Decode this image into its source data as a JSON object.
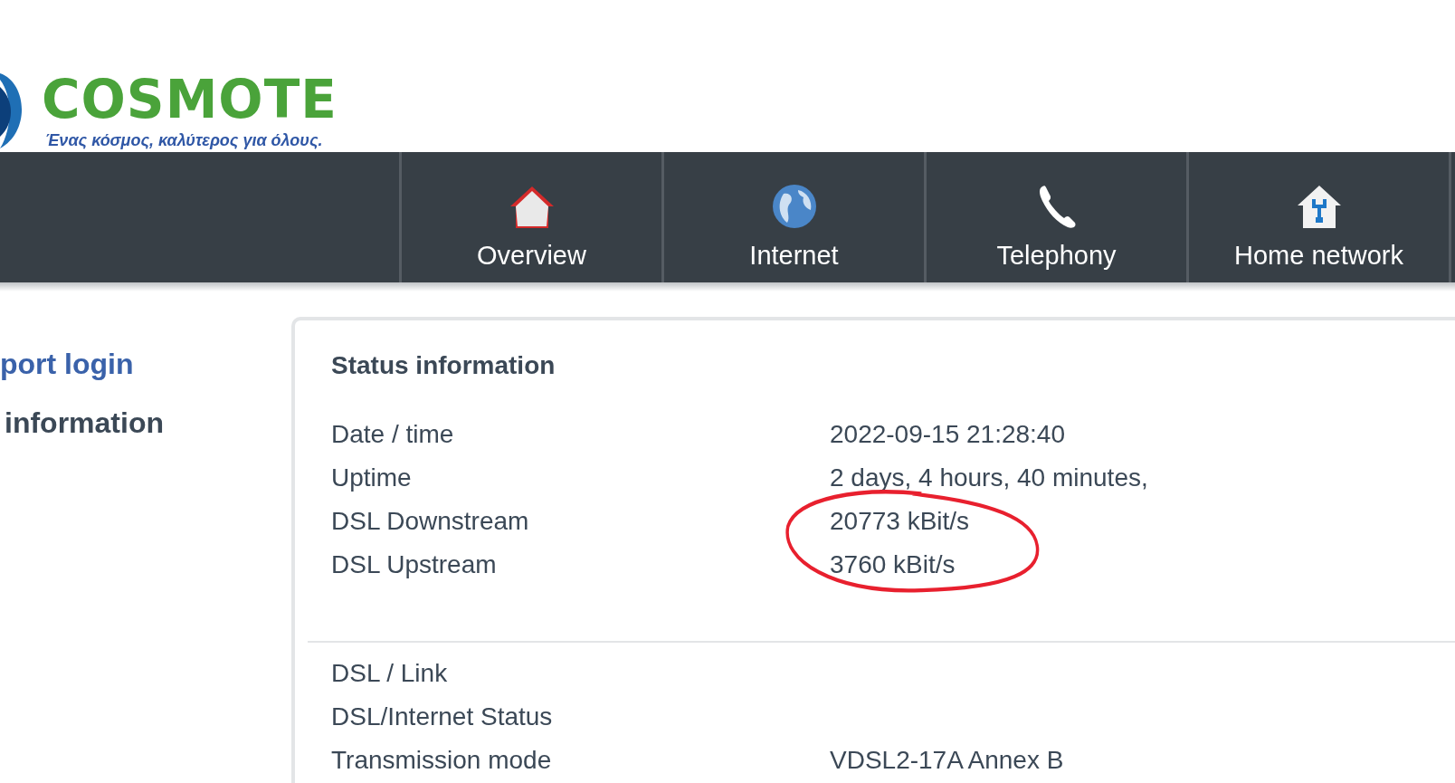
{
  "logo": {
    "name": "COSMOTE",
    "tagline": "Ένας κόσμος, καλύτερος για όλους."
  },
  "nav": [
    {
      "label": "Overview",
      "selected": false
    },
    {
      "label": "Internet",
      "selected": false
    },
    {
      "label": "Telephony",
      "selected": false
    },
    {
      "label": "Home network",
      "selected": false
    }
  ],
  "sidebar": [
    {
      "label": "port login",
      "kind": "link"
    },
    {
      "label": "information",
      "kind": "heading"
    }
  ],
  "panel": {
    "title": "Status information",
    "sections": [
      {
        "rows": [
          {
            "label": "Date / time",
            "value": "2022-09-15 21:28:40"
          },
          {
            "label": "Uptime",
            "value": "2 days, 4 hours, 40 minutes,"
          }
        ],
        "circled_rows": [
          {
            "label": "DSL Downstream",
            "value": "20773 kBit/s"
          },
          {
            "label": "DSL Upstream",
            "value": "3760 kBit/s"
          }
        ]
      },
      {
        "rows": [
          {
            "label": "DSL / Link"
          },
          {
            "label": "DSL/Internet Status"
          },
          {
            "label": "Transmission mode",
            "value": "VDSL2-17A Annex B"
          }
        ]
      }
    ]
  }
}
